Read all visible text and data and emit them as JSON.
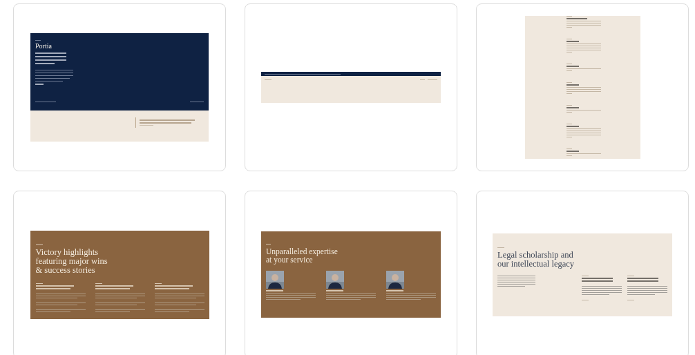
{
  "cards": [
    {
      "kind": "footer",
      "title": "Portia"
    },
    {
      "kind": "banner"
    },
    {
      "kind": "list"
    },
    {
      "kind": "highlights",
      "heading": "Victory highlights\nfeaturing major wins\n& success stories"
    },
    {
      "kind": "team",
      "heading": "Unparalleled expertise\nat your service"
    },
    {
      "kind": "scholarship",
      "heading": "Legal scholarship and\nour intellectual legacy"
    }
  ]
}
